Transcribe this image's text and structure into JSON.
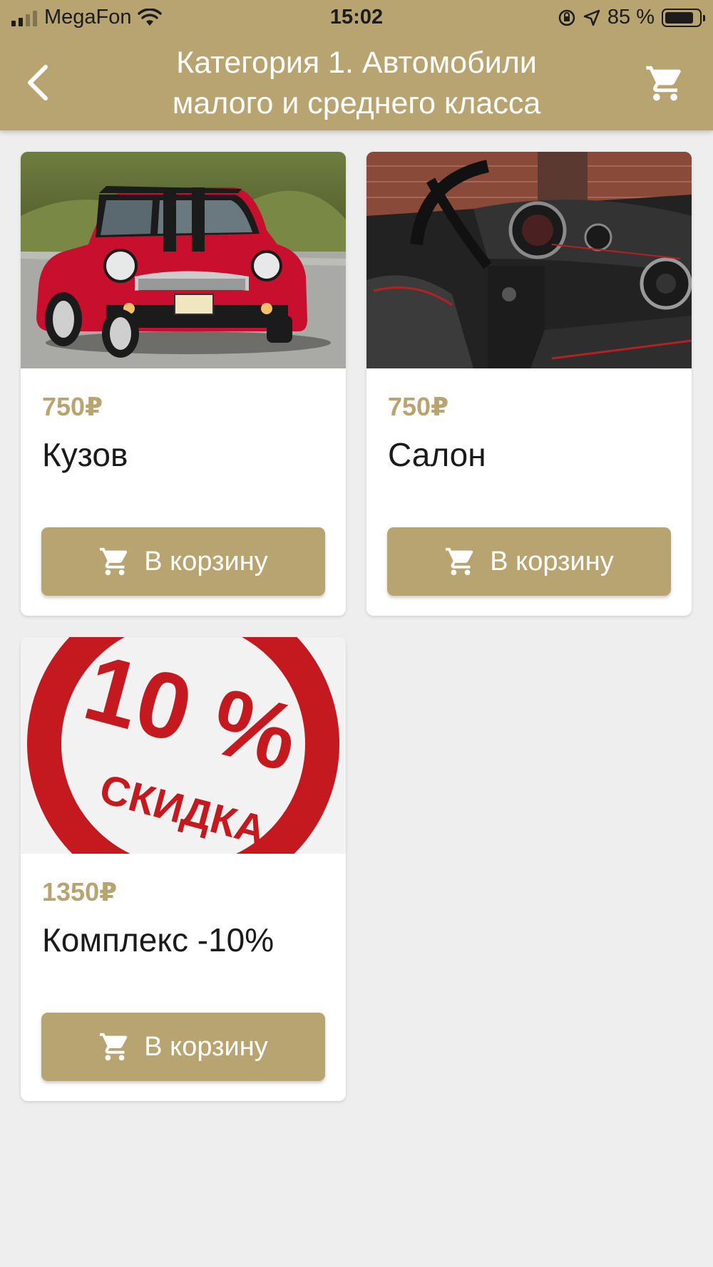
{
  "status_bar": {
    "carrier": "MegaFon",
    "time": "15:02",
    "battery": "85 %",
    "battery_level": 0.85
  },
  "header": {
    "title_line1": "Категория 1. Автомобили",
    "title_line2": "малого и среднего класса",
    "back_icon": "chevron-left-icon",
    "cart_icon": "shopping-cart-icon"
  },
  "products": [
    {
      "price": "750₽",
      "name": "Кузов",
      "button_label": "В корзину"
    },
    {
      "price": "750₽",
      "name": "Салон",
      "button_label": "В корзину"
    },
    {
      "price": "1350₽",
      "name": "Комплекс -10%",
      "button_label": "В корзину",
      "image_text_top": "10 %",
      "image_text_bottom": "СКИДКА"
    }
  ],
  "colors": {
    "accent": "#b8a470",
    "background": "#eeeeee",
    "card": "#ffffff"
  }
}
